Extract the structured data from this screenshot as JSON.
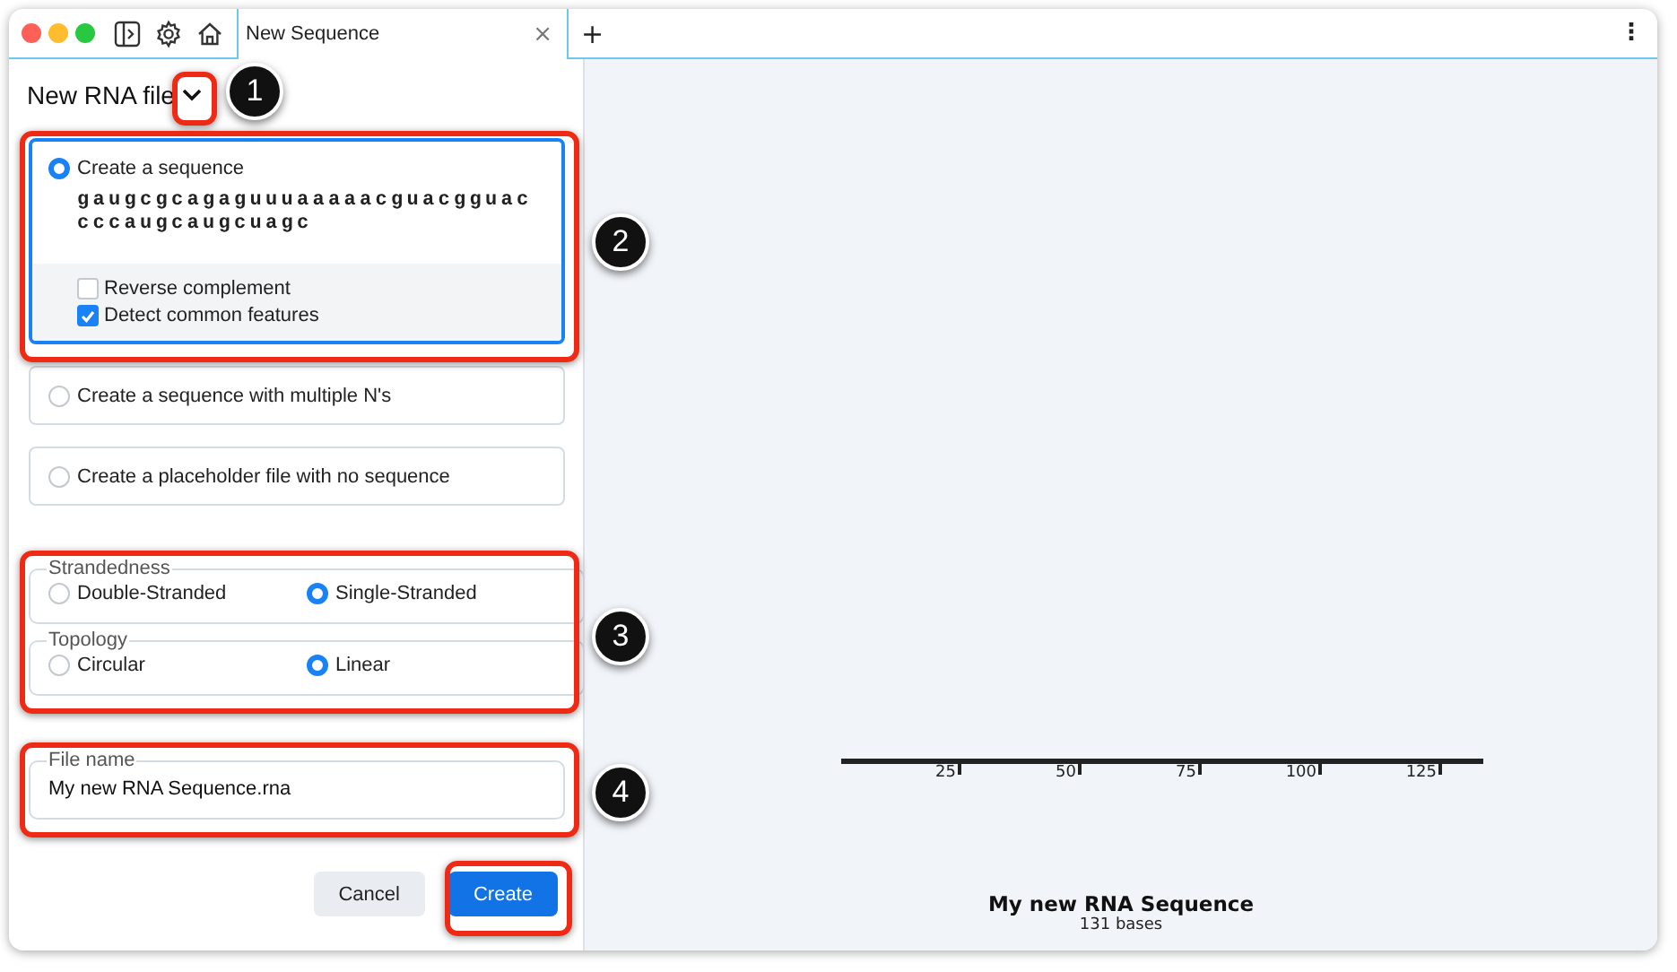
{
  "window": {
    "tab_title": "New Sequence",
    "tab_close": "×",
    "new_tab": "+",
    "menu": "⋮"
  },
  "header": {
    "title": "New RNA file"
  },
  "options": [
    {
      "label": "Create a sequence",
      "selected": true,
      "sequence_lines": [
        "gaugcgcagaguuuaaaaacguacgguac",
        "cccaugcaugcuagc"
      ],
      "checkboxes": [
        {
          "label": "Reverse complement",
          "checked": false
        },
        {
          "label": "Detect common features",
          "checked": true
        }
      ]
    },
    {
      "label": "Create a sequence with multiple N's",
      "selected": false
    },
    {
      "label": "Create a placeholder file with no sequence",
      "selected": false
    }
  ],
  "strandedness": {
    "legend": "Strandedness",
    "choices": [
      {
        "label": "Double-Stranded",
        "selected": false
      },
      {
        "label": "Single-Stranded",
        "selected": true
      }
    ]
  },
  "topology": {
    "legend": "Topology",
    "choices": [
      {
        "label": "Circular",
        "selected": false
      },
      {
        "label": "Linear",
        "selected": true
      }
    ]
  },
  "file_name": {
    "label": "File name",
    "value": "My new RNA Sequence.rna"
  },
  "buttons": [
    {
      "label": "Cancel",
      "kind": "secondary"
    },
    {
      "label": "Create",
      "kind": "primary"
    }
  ],
  "map": {
    "ticks": [
      "25",
      "50",
      "75",
      "100",
      "125"
    ],
    "title": "My new RNA Sequence",
    "subtitle": "131 bases"
  },
  "callouts": [
    "1",
    "2",
    "3",
    "4"
  ]
}
